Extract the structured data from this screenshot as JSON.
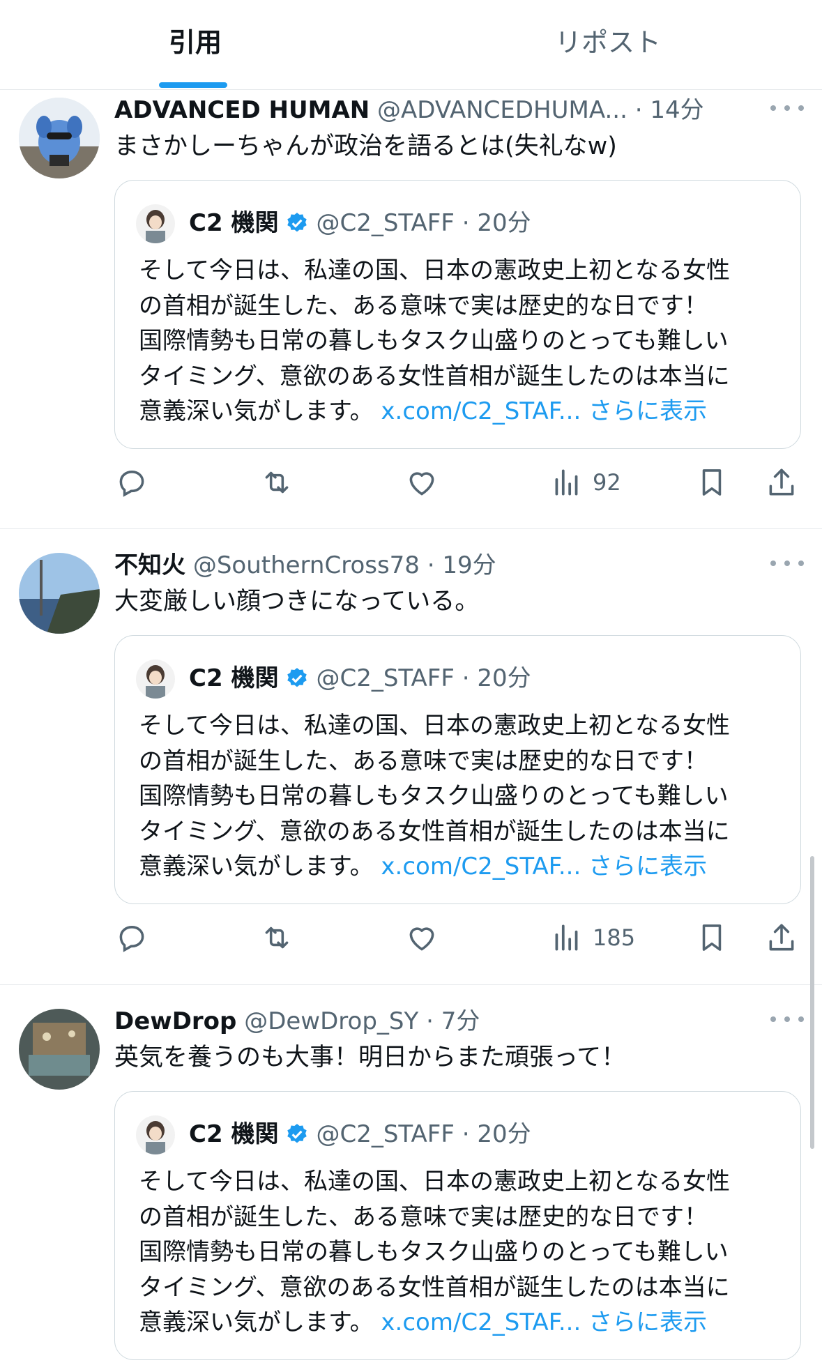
{
  "tabs": [
    {
      "label": "引用"
    },
    {
      "label": "リポスト"
    }
  ],
  "quoted_post": {
    "name": "C2 機関",
    "handle": "@C2_STAFF",
    "time": "20分",
    "lines": [
      "そして今日は、私達の国、日本の憲政史上初となる女性",
      "の首相が誕生した、ある意味で実は歴史的な日です！",
      "国際情勢も日常の暮しもタスク山盛りのとっても難しい",
      "タイミング、意欲のある女性首相が誕生したのは本当に"
    ],
    "last_line": "意義深い気がします。",
    "link": "x.com/C2_STAF...",
    "show_more": "さらに表示"
  },
  "posts": [
    {
      "name": "ADVANCED HUMAN",
      "handle": "@ADVANCEDHUMA...",
      "time": "14分",
      "text": "まさかしーちゃんが政治を語るとは(失礼なw)",
      "views": "92"
    },
    {
      "name": "不知火",
      "handle": "@SouthernCross78",
      "time": "19分",
      "text": "大変厳しい顔つきになっている。",
      "views": "185"
    },
    {
      "name": "DewDrop",
      "handle": "@DewDrop_SY",
      "time": "7分",
      "text": "英気を養うのも大事！明日からまた頑張って！",
      "views": ""
    }
  ],
  "icons": {
    "reply": "reply-icon",
    "repost": "repost-icon",
    "like": "like-icon",
    "views": "views-icon",
    "bookmark": "bookmark-icon",
    "share": "share-icon",
    "verified": "verified-badge-icon",
    "more": "more-icon"
  },
  "colors": {
    "accent": "#1d9bf0",
    "text": "#0f1419",
    "muted": "#536471",
    "border": "#cfd9de"
  }
}
